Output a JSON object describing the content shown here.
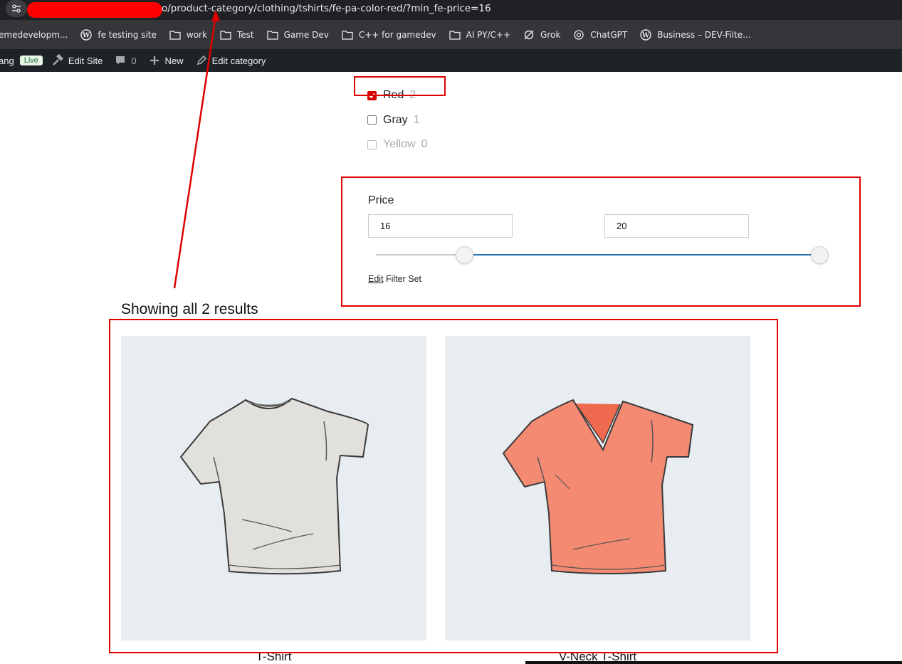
{
  "browser": {
    "url_visible": "o/product-category/clothing/tshirts/fe-pa-color-red/?min_fe-price=16",
    "bookmarks": [
      {
        "label": "emedevelopm...",
        "icon": "none"
      },
      {
        "label": "fe testing site",
        "icon": "wordpress-icon"
      },
      {
        "label": "work",
        "icon": "folder-icon"
      },
      {
        "label": "Test",
        "icon": "folder-icon"
      },
      {
        "label": "Game Dev",
        "icon": "folder-icon"
      },
      {
        "label": "C++ for gamedev",
        "icon": "folder-icon"
      },
      {
        "label": "AI PY/C++",
        "icon": "folder-icon"
      },
      {
        "label": "Grok",
        "icon": "grok-icon"
      },
      {
        "label": "ChatGPT",
        "icon": "chatgpt-icon"
      },
      {
        "label": "Business – DEV-Filte...",
        "icon": "wordpress-icon"
      }
    ]
  },
  "adminbar": {
    "site_name": "ang",
    "live_badge": "Live",
    "edit_site": "Edit Site",
    "comments_count": "0",
    "new_label": "New",
    "edit_category": "Edit category"
  },
  "filters": {
    "colors": [
      {
        "name": "Red",
        "count": "2",
        "checked": true,
        "disabled": false
      },
      {
        "name": "Gray",
        "count": "1",
        "checked": false,
        "disabled": false
      },
      {
        "name": "Yellow",
        "count": "0",
        "checked": false,
        "disabled": true
      }
    ],
    "price": {
      "title": "Price",
      "min_value": "16",
      "max_value": "20",
      "slider_min_fraction": 0.2,
      "slider_max_fraction": 1.0
    },
    "edit_link": "Edit",
    "edit_suffix": " Filter Set"
  },
  "results": {
    "count_text": "Showing all 2 results",
    "products": [
      {
        "title": "T-Shirt",
        "color": "#e2e0dc"
      },
      {
        "title": "V-Neck T-Shirt",
        "color": "#f58a73"
      }
    ]
  },
  "colors": {
    "annotation_red": "#e00000",
    "slider_blue": "#2271b1",
    "product_bg": "#e7edf0"
  }
}
